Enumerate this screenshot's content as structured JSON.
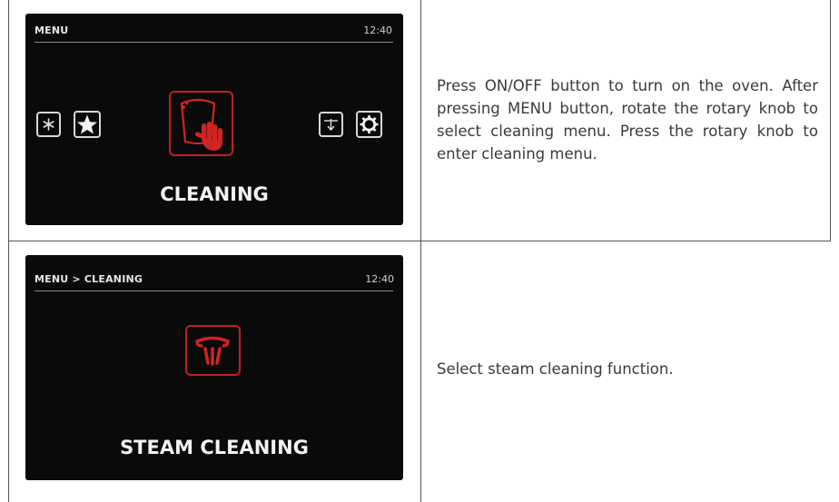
{
  "rows": [
    {
      "screen": {
        "header": "MENU",
        "time": "12:40",
        "icons": [
          "snowflake-icon",
          "star-icon",
          "hand-cleaning-icon",
          "defrost-icon",
          "gear-icon"
        ],
        "label": "CLEANING",
        "accent_color": "#c0201f"
      },
      "description": "Press ON/OFF button to turn on the oven. After pressing MENU button, rotate the rotary knob to select cleaning menu. Press the rotary knob to enter cleaning menu."
    },
    {
      "screen": {
        "header": "MENU > CLEANING",
        "time": "12:40",
        "icons": [
          "steam-cleaning-icon"
        ],
        "label": "STEAM CLEANING",
        "accent_color": "#c0201f"
      },
      "description": "Select steam cleaning function."
    }
  ]
}
